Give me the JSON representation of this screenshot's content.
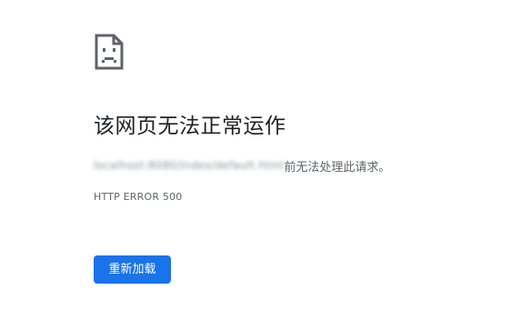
{
  "error_page": {
    "icon": "sad-document-icon",
    "title": "该网页无法正常运作",
    "description": {
      "host": "localhost:8080/index/default.html",
      "suffix": "前无法处理此请求。"
    },
    "error_code": "HTTP ERROR 500",
    "reload_button_label": "重新加载"
  },
  "colors": {
    "background": "#ffffff",
    "title_text": "#202124",
    "secondary_text": "#5f6368",
    "icon": "#5f6368",
    "button_background": "#1a73e8",
    "button_text": "#ffffff"
  }
}
